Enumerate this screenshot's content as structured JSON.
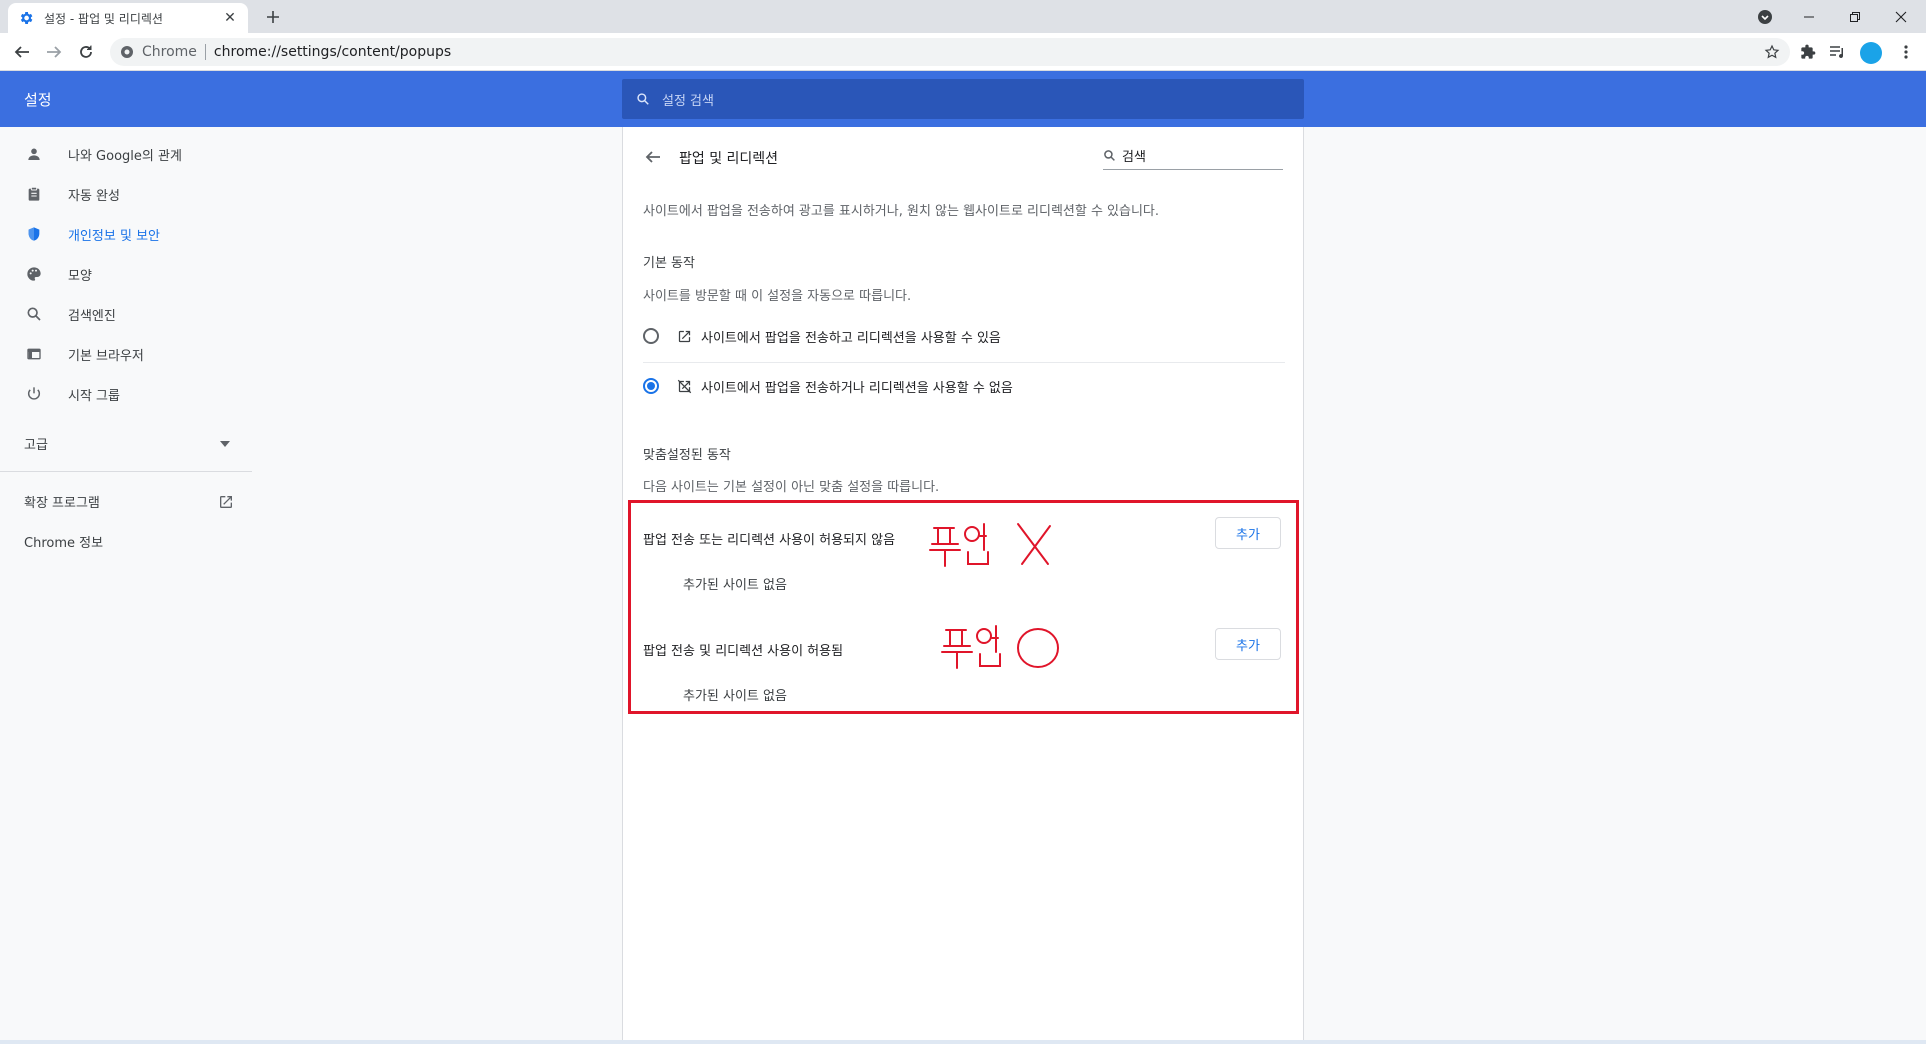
{
  "browser": {
    "tab_title": "설정 - 팝업 및 리디렉션",
    "tab_close": "✕",
    "new_tab": "+",
    "omnibox_origin": "Chrome",
    "omnibox_url": "chrome://settings/content/popups"
  },
  "header": {
    "title": "설정",
    "search_placeholder": "설정 검색"
  },
  "sidebar": {
    "items": [
      {
        "label": "나와 Google의 관계",
        "icon": "person-icon"
      },
      {
        "label": "자동 완성",
        "icon": "clipboard-icon"
      },
      {
        "label": "개인정보 및 보안",
        "icon": "shield-icon"
      },
      {
        "label": "모양",
        "icon": "palette-icon"
      },
      {
        "label": "검색엔진",
        "icon": "search-icon"
      },
      {
        "label": "기본 브라우저",
        "icon": "browser-icon"
      },
      {
        "label": "시작 그룹",
        "icon": "power-icon"
      }
    ],
    "advanced_label": "고급",
    "extensions_label": "확장 프로그램",
    "about_label": "Chrome 정보"
  },
  "main": {
    "page_title": "팝업 및 리디렉션",
    "search_value": "검색",
    "description": "사이트에서 팝업을 전송하여 광고를 표시하거나, 원치 않는 웹사이트로 리디렉션할 수 있습니다.",
    "default_heading": "기본 동작",
    "default_desc": "사이트를 방문할 때 이 설정을 자동으로 따릅니다.",
    "options": [
      {
        "label": "사이트에서 팝업을 전송하고 리디렉션을 사용할 수 있음",
        "selected": false
      },
      {
        "label": "사이트에서 팝업을 전송하거나 리디렉션을 사용할 수 없음",
        "selected": true
      }
    ],
    "custom_heading": "맞춤설정된 동작",
    "custom_desc": "다음 사이트는 기본 설정이 아닌 맞춤 설정을 따릅니다.",
    "blocked_title": "팝업 전송 또는 리디렉션 사용이 허용되지 않음",
    "blocked_empty": "추가된 사이트 없음",
    "allowed_title": "팝업 전송 및 리디렉션 사용이 허용됨",
    "allowed_empty": "추가된 사이트 없음",
    "add_label": "추가"
  },
  "colors": {
    "header_blue": "#3b6fe0",
    "accent": "#1a73e8",
    "annotation_red": "#e0152a"
  }
}
